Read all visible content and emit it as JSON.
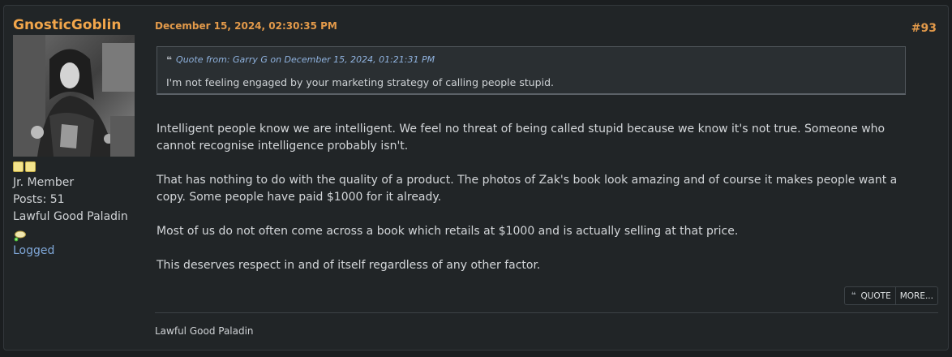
{
  "poster": {
    "name": "GnosticGoblin",
    "rank": "Jr. Member",
    "posts": "Posts: 51",
    "title": "Lawful Good Paladin",
    "status": "Logged",
    "stars_count": 2,
    "avatar_icon": "avatar-image"
  },
  "post": {
    "date": "December 15, 2024, 02:30:35 PM",
    "number": "#93",
    "quote": {
      "header": "Quote from: Garry G on December 15, 2024, 01:21:31 PM",
      "text": "I'm not feeling engaged by your marketing strategy of calling people stupid."
    },
    "paragraphs": [
      "Intelligent people know we are intelligent. We feel no threat of being called stupid because we know it's not true. Someone who cannot recognise intelligence probably isn't.",
      "That has nothing to do with the quality of a product. The photos of Zak's book look amazing and of course it makes people want a copy. Some people have paid $1000 for it already.",
      "Most of us do not often come across a book which retails at $1000 and is actually selling at that price.",
      "This deserves respect in and of itself regardless of any other factor."
    ],
    "signature": "Lawful Good Paladin"
  },
  "actions": {
    "quote_label": "QUOTE",
    "more_label": "MORE..."
  },
  "colors": {
    "accent": "#f2a64b",
    "link": "#7fa7d8",
    "background": "#212527"
  }
}
